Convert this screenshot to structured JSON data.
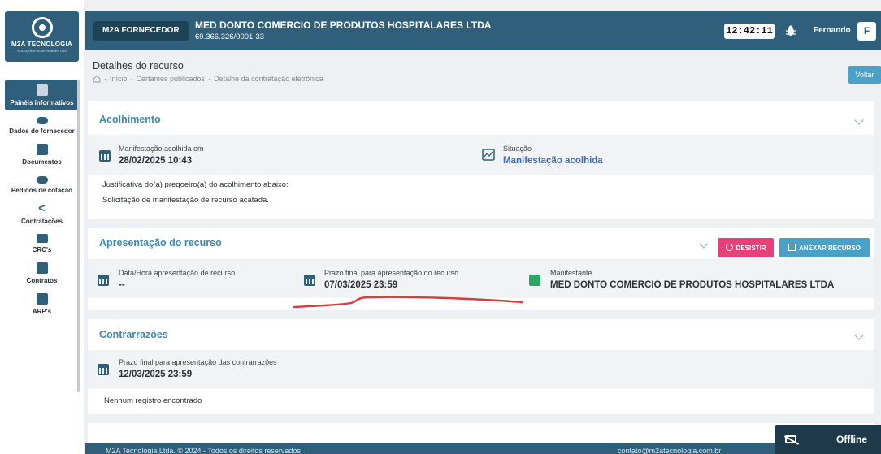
{
  "sidebar": {
    "logo_text": "M2A TECNOLOGIA",
    "logo_sub": "SOLUÇÕES GOVERNAMENTAIS",
    "items": [
      {
        "label": "Painéis informativos",
        "icon": "dashboard-icon"
      },
      {
        "label": "Dados do fornecedor",
        "icon": "toggle-icon"
      },
      {
        "label": "Documentos",
        "icon": "document-icon"
      },
      {
        "label": "Pedidos de cotação",
        "icon": "quote-icon"
      },
      {
        "label": "Contratações",
        "icon": "share-icon"
      },
      {
        "label": "CRC's",
        "icon": "mail-icon"
      },
      {
        "label": "Contratos",
        "icon": "edit-icon"
      },
      {
        "label": "ARP's",
        "icon": "arp-icon"
      }
    ]
  },
  "header": {
    "badge": "M2A FORNECEDOR",
    "company_name": "MED DONTO COMERCIO DE PRODUTOS HOSPITALARES LTDA",
    "cnpj": "69.366.326/0001-33",
    "clock": "12:42:11",
    "user_name": "Fernando",
    "user_initial": "F"
  },
  "page": {
    "title": "Detalhes do recurso",
    "breadcrumb": [
      "Início",
      "Certames publicados",
      "Detalhe da contratação eletrônica"
    ],
    "back_button": "Voltar"
  },
  "acolhimento": {
    "title": "Acolhimento",
    "date_label": "Manifestação acolhida em",
    "date_value": "28/02/2025 10:43",
    "status_label": "Situação",
    "status_value": "Manifestação acolhida",
    "justification_label": "Justificativa do(a) pregoeiro(a) do acolhimento abaixo:",
    "justification_text": "Solicitação de manifestação de recurso acatada."
  },
  "apresentacao": {
    "title": "Apresentação do recurso",
    "desistir_label": "DESISTIR",
    "anexar_label": "ANEXAR RECURSO",
    "datetime_label": "Data/Hora apresentação de recurso",
    "datetime_value": "--",
    "deadline_label": "Prazo final para apresentação do recurso",
    "deadline_value": "07/03/2025 23:59",
    "manifestante_label": "Manifestante",
    "manifestante_value": "MED DONTO COMERCIO DE PRODUTOS HOSPITALARES LTDA"
  },
  "contrarrazoes": {
    "title": "Contrarrazões",
    "deadline_label": "Prazo final para apresentação das contrarrazões",
    "deadline_value": "12/03/2025 23:59",
    "empty_text": "Nenhum registro encontrado"
  },
  "footer": {
    "left": "M2A Tecnologia Ltda. © 2024 - Todos os direitos reservados",
    "right": "contato@m2atecnologia.com.br"
  },
  "offline": {
    "label": "Offline"
  },
  "colors": {
    "primary": "#2f5f7a",
    "accent": "#3e8ab0",
    "danger": "#e8417a",
    "info": "#4aa0c6",
    "annotation": "#e0393b"
  }
}
